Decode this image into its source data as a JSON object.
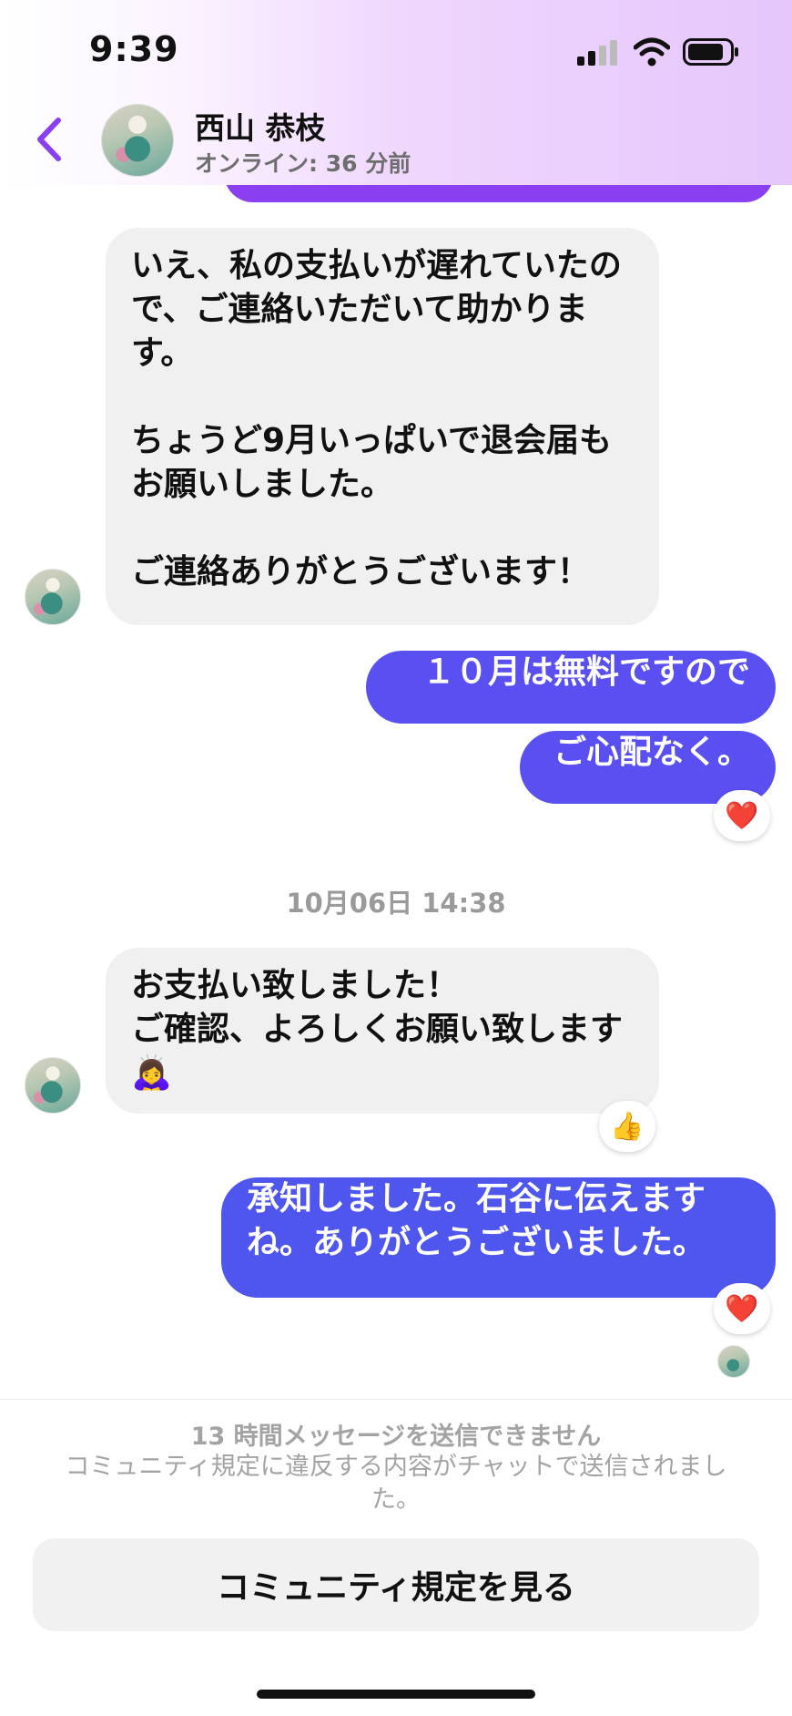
{
  "status_bar": {
    "time": "9:39"
  },
  "header": {
    "contact_name": "西山 恭枝",
    "contact_status": "オンライン: 36 分前"
  },
  "messages": [
    {
      "direction": "incoming",
      "text": "いえ、私の支払いが遅れていたので、ご連絡いただいて助かります。\n\nちょうど9月いっぱいで退会届もお願いしました。\n\nご連絡ありがとうございます！"
    },
    {
      "direction": "outgoing",
      "text": "１０月は無料ですので"
    },
    {
      "direction": "outgoing",
      "text": "ご心配なく。",
      "reaction": "❤️"
    },
    {
      "direction": "incoming",
      "text": "お支払い致しました！\nご確認、よろしくお願い致します🙇‍♀️",
      "reaction": "👍"
    },
    {
      "direction": "outgoing",
      "text": "承知しました。石谷に伝えますね。ありがとうございました。",
      "reaction": "❤️"
    }
  ],
  "date_separator": "10月06日 14:38",
  "footer": {
    "notice_title": "13 時間メッセージを送信できません",
    "notice_body": "コミュニティ規定に違反する内容がチャットで送信されました。",
    "rules_button_label": "コミュニティ規定を見る"
  },
  "icons": {
    "back": "chevron-left-icon",
    "signal": "cellular-signal-icon",
    "wifi": "wifi-icon",
    "battery": "battery-icon"
  },
  "colors": {
    "outgoing_bubble": "#5a4ff0",
    "incoming_bubble": "#f0f0f0",
    "accent": "#8a3ff0"
  }
}
